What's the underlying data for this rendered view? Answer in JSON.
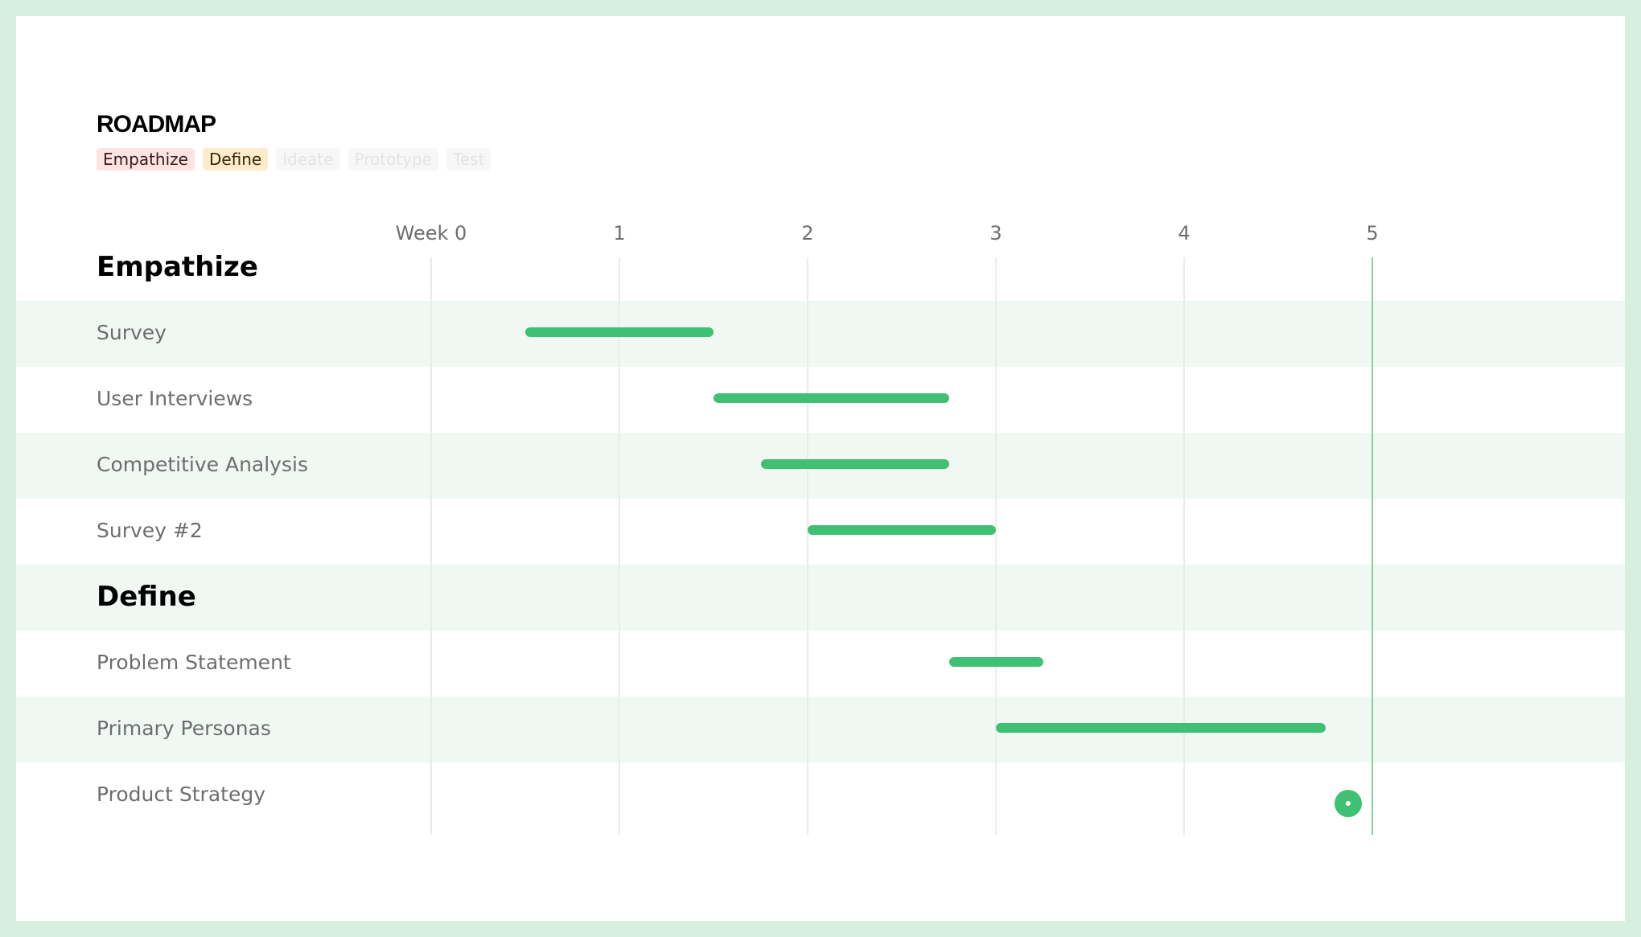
{
  "title": "ROADMAP",
  "phases": [
    {
      "label": "Empathize",
      "active": true
    },
    {
      "label": "Define",
      "active": true
    },
    {
      "label": "Ideate",
      "active": false
    },
    {
      "label": "Prototype",
      "active": false
    },
    {
      "label": "Test",
      "active": false
    }
  ],
  "colors": {
    "accent": "#3fc072",
    "today_line": "#7fd39f",
    "row_shade": "#f1f8f3",
    "empathize_badge": "#fde3e1",
    "define_badge": "#fdebcc",
    "frame": "#d5efe0"
  },
  "chart_data": {
    "type": "gantt",
    "axis_labels": [
      "Week 0",
      "1",
      "2",
      "3",
      "4",
      "5"
    ],
    "weeks": [
      0,
      1,
      2,
      3,
      4,
      5
    ],
    "today_week": 5,
    "groups": [
      {
        "name": "Empathize",
        "tasks": [
          {
            "name": "Survey",
            "start": 0.5,
            "end": 1.5
          },
          {
            "name": "User Interviews",
            "start": 1.5,
            "end": 2.75
          },
          {
            "name": "Competitive Analysis",
            "start": 1.75,
            "end": 2.75
          },
          {
            "name": "Survey #2",
            "start": 2.0,
            "end": 3.0
          }
        ]
      },
      {
        "name": "Define",
        "tasks": [
          {
            "name": "Problem Statement",
            "start": 2.75,
            "end": 3.25
          },
          {
            "name": "Primary Personas",
            "start": 3.0,
            "end": 4.75
          },
          {
            "name": "Product Strategy",
            "milestone": 4.87
          }
        ]
      }
    ]
  }
}
